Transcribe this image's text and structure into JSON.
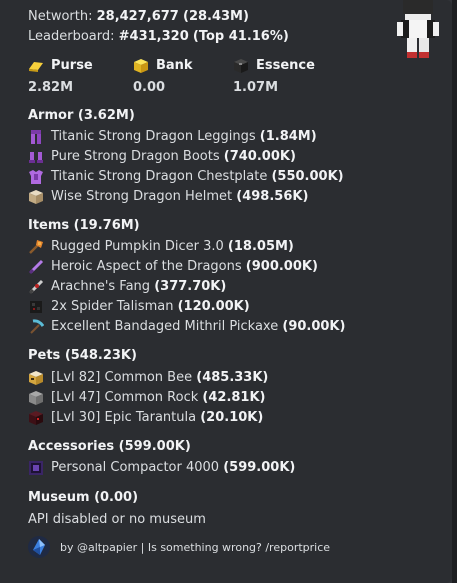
{
  "stats": {
    "networth_label": "Networth:",
    "networth_value": "28,427,677",
    "networth_short": "(28.43M)",
    "leaderboard_label": "Leaderboard:",
    "leaderboard_value": "#431,320",
    "leaderboard_top": "(Top 41.16%)"
  },
  "fields": [
    {
      "name": "Purse",
      "value": "2.82M",
      "icon": "gold-ingot-icon"
    },
    {
      "name": "Bank",
      "value": "0.00",
      "icon": "gold-block-icon"
    },
    {
      "name": "Essence",
      "value": "1.07M",
      "icon": "wither-essence-icon"
    }
  ],
  "armor": {
    "title": "Armor (3.62M)",
    "items": [
      {
        "name": "Titanic Strong Dragon Leggings",
        "price": "(1.84M)",
        "icon": "dragon-leggings-icon"
      },
      {
        "name": "Pure Strong Dragon Boots",
        "price": "(740.00K)",
        "icon": "dragon-boots-icon"
      },
      {
        "name": "Titanic Strong Dragon Chestplate",
        "price": "(550.00K)",
        "icon": "dragon-chestplate-icon"
      },
      {
        "name": "Wise Strong Dragon Helmet",
        "price": "(498.56K)",
        "icon": "dragon-helmet-icon"
      }
    ]
  },
  "items": {
    "title": "Items (19.76M)",
    "items": [
      {
        "name": "Rugged Pumpkin Dicer 3.0",
        "price": "(18.05M)",
        "icon": "pumpkin-dicer-icon"
      },
      {
        "name": "Heroic Aspect of the Dragons",
        "price": "(900.00K)",
        "icon": "sword-icon"
      },
      {
        "name": "Arachne's Fang",
        "price": "(377.70K)",
        "icon": "arachne-fang-icon"
      },
      {
        "name": "Spider Talisman",
        "price": "(120.00K)",
        "count": "2x",
        "icon": "spider-talisman-icon"
      },
      {
        "name": "Excellent Bandaged Mithril Pickaxe",
        "price": "(90.00K)",
        "icon": "pickaxe-icon"
      }
    ]
  },
  "pets": {
    "title": "Pets (548.23K)",
    "items": [
      {
        "name": "[Lvl 82] Common Bee",
        "price": "(485.33K)",
        "icon": "bee-pet-icon"
      },
      {
        "name": "[Lvl 47] Common Rock",
        "price": "(42.81K)",
        "icon": "rock-pet-icon"
      },
      {
        "name": "[Lvl 30] Epic Tarantula",
        "price": "(20.10K)",
        "icon": "tarantula-pet-icon"
      }
    ]
  },
  "accessories": {
    "title": "Accessories (599.00K)",
    "items": [
      {
        "name": "Personal Compactor 4000",
        "price": "(599.00K)",
        "icon": "compactor-icon"
      }
    ]
  },
  "museum": {
    "title": "Museum (0.00)",
    "text": "API disabled or no museum"
  },
  "footer": {
    "text": "by @altpapier | Is something wrong? /reportprice",
    "icon": "footer-gem-icon"
  },
  "thumbnail": {
    "icon": "player-skin-icon"
  }
}
